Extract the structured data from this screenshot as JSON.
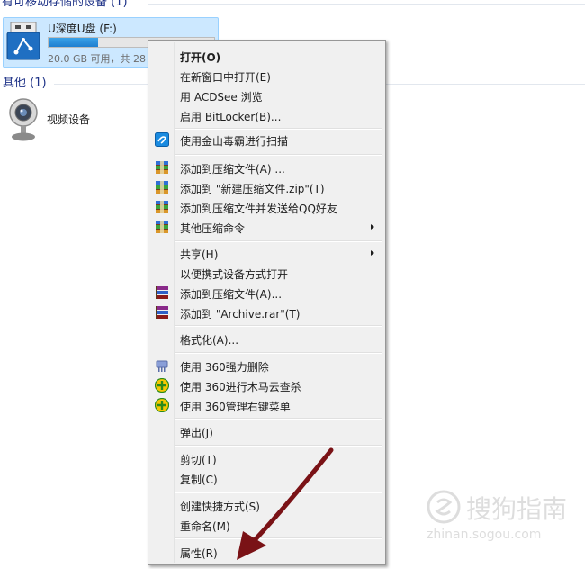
{
  "explorer": {
    "removable_group_header": "有可移动存储的设备 (1)",
    "drive": {
      "name": "U深度U盘 (F:)",
      "space_text": "20.0 GB 可用，共 28",
      "usage_fraction": 0.3
    },
    "other_group_header": "其他 (1)",
    "camera_label": "视频设备"
  },
  "context_menu": {
    "items": [
      {
        "label": "打开(O)",
        "icon": "none"
      },
      {
        "label": "在新窗口中打开(E)",
        "icon": "none"
      },
      {
        "label": "用 ACDSee 浏览",
        "icon": "none"
      },
      {
        "label": "启用 BitLocker(B)...",
        "icon": "none"
      },
      {
        "label": "使用金山毒霸进行扫描",
        "icon": "kingsoft-antivirus-icon"
      },
      {
        "label": "添加到压缩文件(A) ...",
        "icon": "winrar-archive-icon"
      },
      {
        "label": "添加到 \"新建压缩文件.zip\"(T)",
        "icon": "winrar-archive-icon"
      },
      {
        "label": "添加到压缩文件并发送给QQ好友",
        "icon": "winrar-archive-icon"
      },
      {
        "label": "其他压缩命令",
        "icon": "winrar-archive-icon",
        "submenu": true
      },
      {
        "label": "共享(H)",
        "icon": "none",
        "submenu": true
      },
      {
        "label": "以便携式设备方式打开",
        "icon": "none"
      },
      {
        "label": "添加到压缩文件(A)...",
        "icon": "winrar-books-icon"
      },
      {
        "label": "添加到 \"Archive.rar\"(T)",
        "icon": "winrar-books-icon"
      },
      {
        "label": "格式化(A)...",
        "icon": "none"
      },
      {
        "label": "使用 360强力删除",
        "icon": "360-shredder-icon"
      },
      {
        "label": "使用 360进行木马云查杀",
        "icon": "360-security-icon"
      },
      {
        "label": "使用 360管理右键菜单",
        "icon": "360-security-icon"
      },
      {
        "label": "弹出(J)",
        "icon": "none"
      },
      {
        "label": "剪切(T)",
        "icon": "none"
      },
      {
        "label": "复制(C)",
        "icon": "none"
      },
      {
        "label": "创建快捷方式(S)",
        "icon": "none"
      },
      {
        "label": "重命名(M)",
        "icon": "none"
      },
      {
        "label": "属性(R)",
        "icon": "none"
      }
    ]
  },
  "annotation": {
    "arrow_color": "#7a1216"
  },
  "watermark": {
    "text": "搜狗指南",
    "url": "zhinan.sogou.com"
  },
  "colors": {
    "selection_bg": "#cce8ff",
    "group_header": "#1e3287",
    "menu_bg": "#f0f0f0"
  }
}
